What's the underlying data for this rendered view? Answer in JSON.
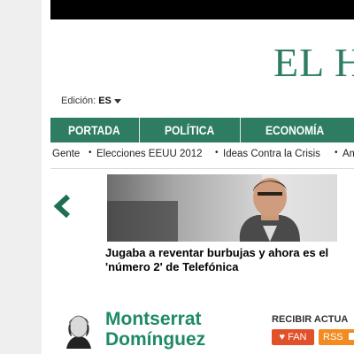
{
  "header": {
    "logo_text": "EL H"
  },
  "edition": {
    "label": "Edición:",
    "value": "ES"
  },
  "nav": {
    "items": [
      {
        "label": "PORTADA"
      },
      {
        "label": "POLÍTICA"
      },
      {
        "label": "ECONOMÍA"
      }
    ]
  },
  "subnav": {
    "items": [
      {
        "label": "Gente"
      },
      {
        "label": "Elecciones EEUU 2012"
      },
      {
        "label": "Ideas Contra la Crisis"
      },
      {
        "label": "Am"
      }
    ]
  },
  "featured": {
    "headline": "Jugaba a reventar burbujas y ahora es el 'número 2' de Telefónica"
  },
  "author": {
    "name_line1": "Montserrat",
    "name_line2": "Domínguez"
  },
  "subscribe": {
    "label": "RECIBIR ACTUA",
    "fan_label": "FAN",
    "rss_label": "RSS"
  },
  "colors": {
    "brand_green": "#2e7d63",
    "fan_orange_red": "#e2502a",
    "rss_orange": "#f28c22"
  },
  "icons": {
    "carousel_prev": "chevron-left-icon",
    "fan": "heart-icon",
    "rss": "rss-icon"
  }
}
